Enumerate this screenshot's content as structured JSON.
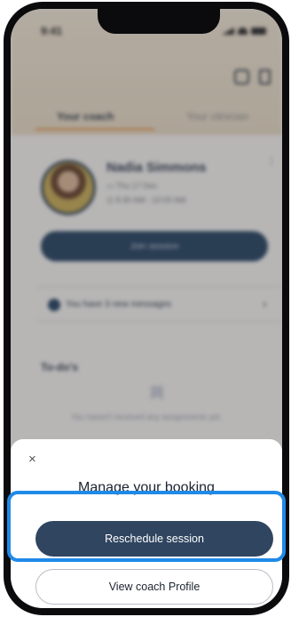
{
  "status_bar": {
    "time": "9:41"
  },
  "background": {
    "tabs": [
      {
        "label": "Your coach",
        "active": true
      },
      {
        "label": "Your clinician",
        "active": false
      }
    ],
    "coach": {
      "name": "Nadia Simmons",
      "date": "Thu 17 Dec",
      "time_range": "9:30 AM - 10:00 AM"
    },
    "join_button_label": "Join session",
    "messages_text": "You have 3 new messages",
    "todo_title": "To-do's",
    "todo_empty_text": "You haven't received any assignments yet."
  },
  "sheet": {
    "close_glyph": "×",
    "title": "Manage your booking",
    "primary_button_label": "Reschedule session",
    "secondary_button_label": "View coach Profile"
  },
  "colors": {
    "primary": "#2f4560",
    "highlight": "#1f8ae8",
    "accent": "#e2a66a"
  },
  "icons": {
    "header_left": "calendar-icon",
    "header_right": "bookmark-icon",
    "messages": "chat-bubble-icon",
    "todo": "bookmark-icon"
  }
}
